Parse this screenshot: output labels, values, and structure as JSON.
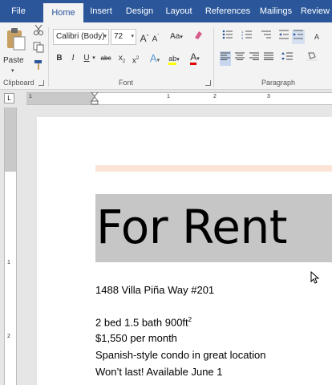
{
  "tabs": [
    "File",
    "Home",
    "Insert",
    "Design",
    "Layout",
    "References",
    "Mailings",
    "Review"
  ],
  "active_tab": "Home",
  "clipboard": {
    "paste_label": "Paste",
    "group_label": "Clipboard"
  },
  "font": {
    "family": "Calibri (Body)",
    "size": "72",
    "change_case": "Aa",
    "group_label": "Font"
  },
  "paragraph": {
    "group_label": "Paragraph"
  },
  "ruler": {
    "h_numbers": [
      "1",
      "2",
      "3"
    ],
    "v_numbers": [
      "1",
      "2"
    ]
  },
  "document": {
    "heading": "For Rent",
    "address": "1488 Villa Piña Way #201",
    "details_line": "2 bed 1.5 bath 900ft",
    "details_sup": "2",
    "price": "$1,550 per month",
    "description": "Spanish-style condo in great location",
    "availability": "Won’t last! Available June 1"
  },
  "colors": {
    "title_bar": "#2b579a",
    "ribbon_bg": "#f3f3f3",
    "highlight": "#c6c6c6",
    "peach_border": "#fbe4d5"
  }
}
